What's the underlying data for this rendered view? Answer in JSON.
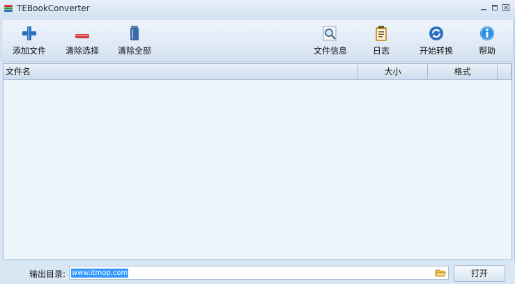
{
  "window": {
    "title": "TEBookConverter",
    "controls": [
      "minimize-icon",
      "maximize-icon",
      "close-icon"
    ]
  },
  "toolbar": {
    "buttons": [
      {
        "label": "添加文件",
        "icon": "plus-icon",
        "color": "#2a6fc0"
      },
      {
        "label": "清除选择",
        "icon": "minus-icon",
        "color": "#d23a3a"
      },
      {
        "label": "清除全部",
        "icon": "trash-icon",
        "color": "#3b6aa6"
      },
      {
        "label": "文件信息",
        "icon": "magnifier-icon",
        "color": "#5b87b5"
      },
      {
        "label": "日志",
        "icon": "clipboard-icon",
        "color": "#c79a3a"
      },
      {
        "label": "开始转换",
        "icon": "refresh-icon",
        "color": "#2a6fc0"
      },
      {
        "label": "帮助",
        "icon": "info-icon",
        "color": "#2f8fe0"
      }
    ]
  },
  "table": {
    "columns": [
      "文件名",
      "大小",
      "格式"
    ],
    "rows": []
  },
  "footer": {
    "output_label": "输出目录:",
    "output_value": "www.itmop.com",
    "open_label": "打开"
  }
}
